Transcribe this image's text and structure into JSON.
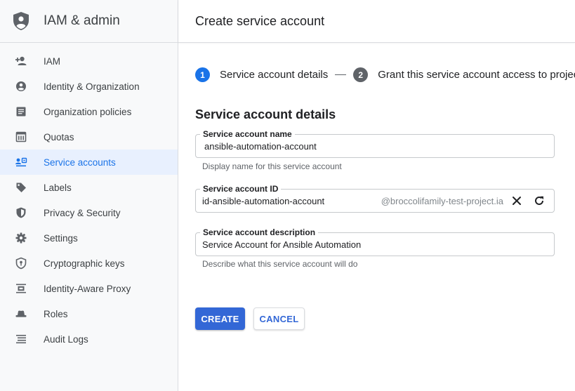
{
  "colors": {
    "accent": "#1a73e8",
    "primary_button": "#3367d6",
    "active_nav_bg": "#e8f0fe"
  },
  "sidebar": {
    "product_name": "IAM & admin",
    "logo_icon": "shield-person-icon",
    "items": [
      {
        "label": "IAM",
        "icon": "person-add-icon"
      },
      {
        "label": "Identity & Organization",
        "icon": "account-circle-icon"
      },
      {
        "label": "Organization policies",
        "icon": "article-icon"
      },
      {
        "label": "Quotas",
        "icon": "calendar-icon"
      },
      {
        "label": "Service accounts",
        "icon": "service-account-icon",
        "active": true
      },
      {
        "label": "Labels",
        "icon": "label-icon"
      },
      {
        "label": "Privacy & Security",
        "icon": "shield-icon"
      },
      {
        "label": "Settings",
        "icon": "gear-icon"
      },
      {
        "label": "Cryptographic keys",
        "icon": "key-shield-icon"
      },
      {
        "label": "Identity-Aware Proxy",
        "icon": "proxy-icon"
      },
      {
        "label": "Roles",
        "icon": "hat-icon"
      },
      {
        "label": "Audit Logs",
        "icon": "list-icon"
      }
    ]
  },
  "header": {
    "title": "Create service account"
  },
  "stepper": {
    "steps": [
      {
        "number": "1",
        "label": "Service account details"
      },
      {
        "number": "2",
        "label": "Grant this service account access to project"
      }
    ]
  },
  "form": {
    "section_title": "Service account details",
    "name": {
      "label": "Service account name",
      "value": "ansible-automation-account",
      "hint": "Display name for this service account"
    },
    "id": {
      "label": "Service account ID",
      "value": "id-ansible-automation-account",
      "suffix": "@broccolifamily-test-project.ia"
    },
    "description": {
      "label": "Service account description",
      "value": "Service Account for Ansible Automation",
      "hint": "Describe what this service account will do"
    }
  },
  "actions": {
    "create_label": "CREATE",
    "cancel_label": "CANCEL"
  }
}
